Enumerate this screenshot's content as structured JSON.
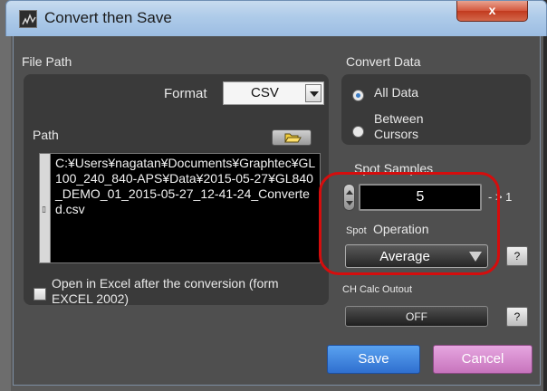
{
  "window": {
    "title": "Convert then Save",
    "close_glyph": "x"
  },
  "file_path": {
    "section_label": "File Path",
    "format_label": "Format",
    "format_value": "CSV",
    "path_label": "Path",
    "path_value": "C:¥Users¥nagatan¥Documents¥Graphtec¥GL100_240_840-APS¥Data¥2015-05-27¥GL840_DEMO_01_2015-05-27_12-41-24_Converted.csv",
    "open_excel_label": "Open in Excel after the conversion (form EXCEL 2002)",
    "open_excel_checked": false
  },
  "convert_data": {
    "section_label": "Convert Data",
    "options": [
      {
        "label": "All Data",
        "selected": true
      },
      {
        "label": "Between Cursors",
        "selected": false
      }
    ]
  },
  "spot": {
    "samples_label": "Spot Samples",
    "samples_value": "5",
    "arrow_text": "- > 1",
    "operation_prefix": "Spot",
    "operation_label": "Operation",
    "operation_value": "Average",
    "help_label": "?"
  },
  "ch_calc": {
    "label": "CH Calc Outout",
    "value": "OFF",
    "help_label": "?"
  },
  "buttons": {
    "save": "Save",
    "cancel": "Cancel"
  },
  "colors": {
    "save": "#3a82de",
    "cancel": "#d58ccd",
    "highlight": "#d50d0d"
  },
  "icons": {
    "app": "waveform-icon",
    "folder": "folder-icon"
  }
}
